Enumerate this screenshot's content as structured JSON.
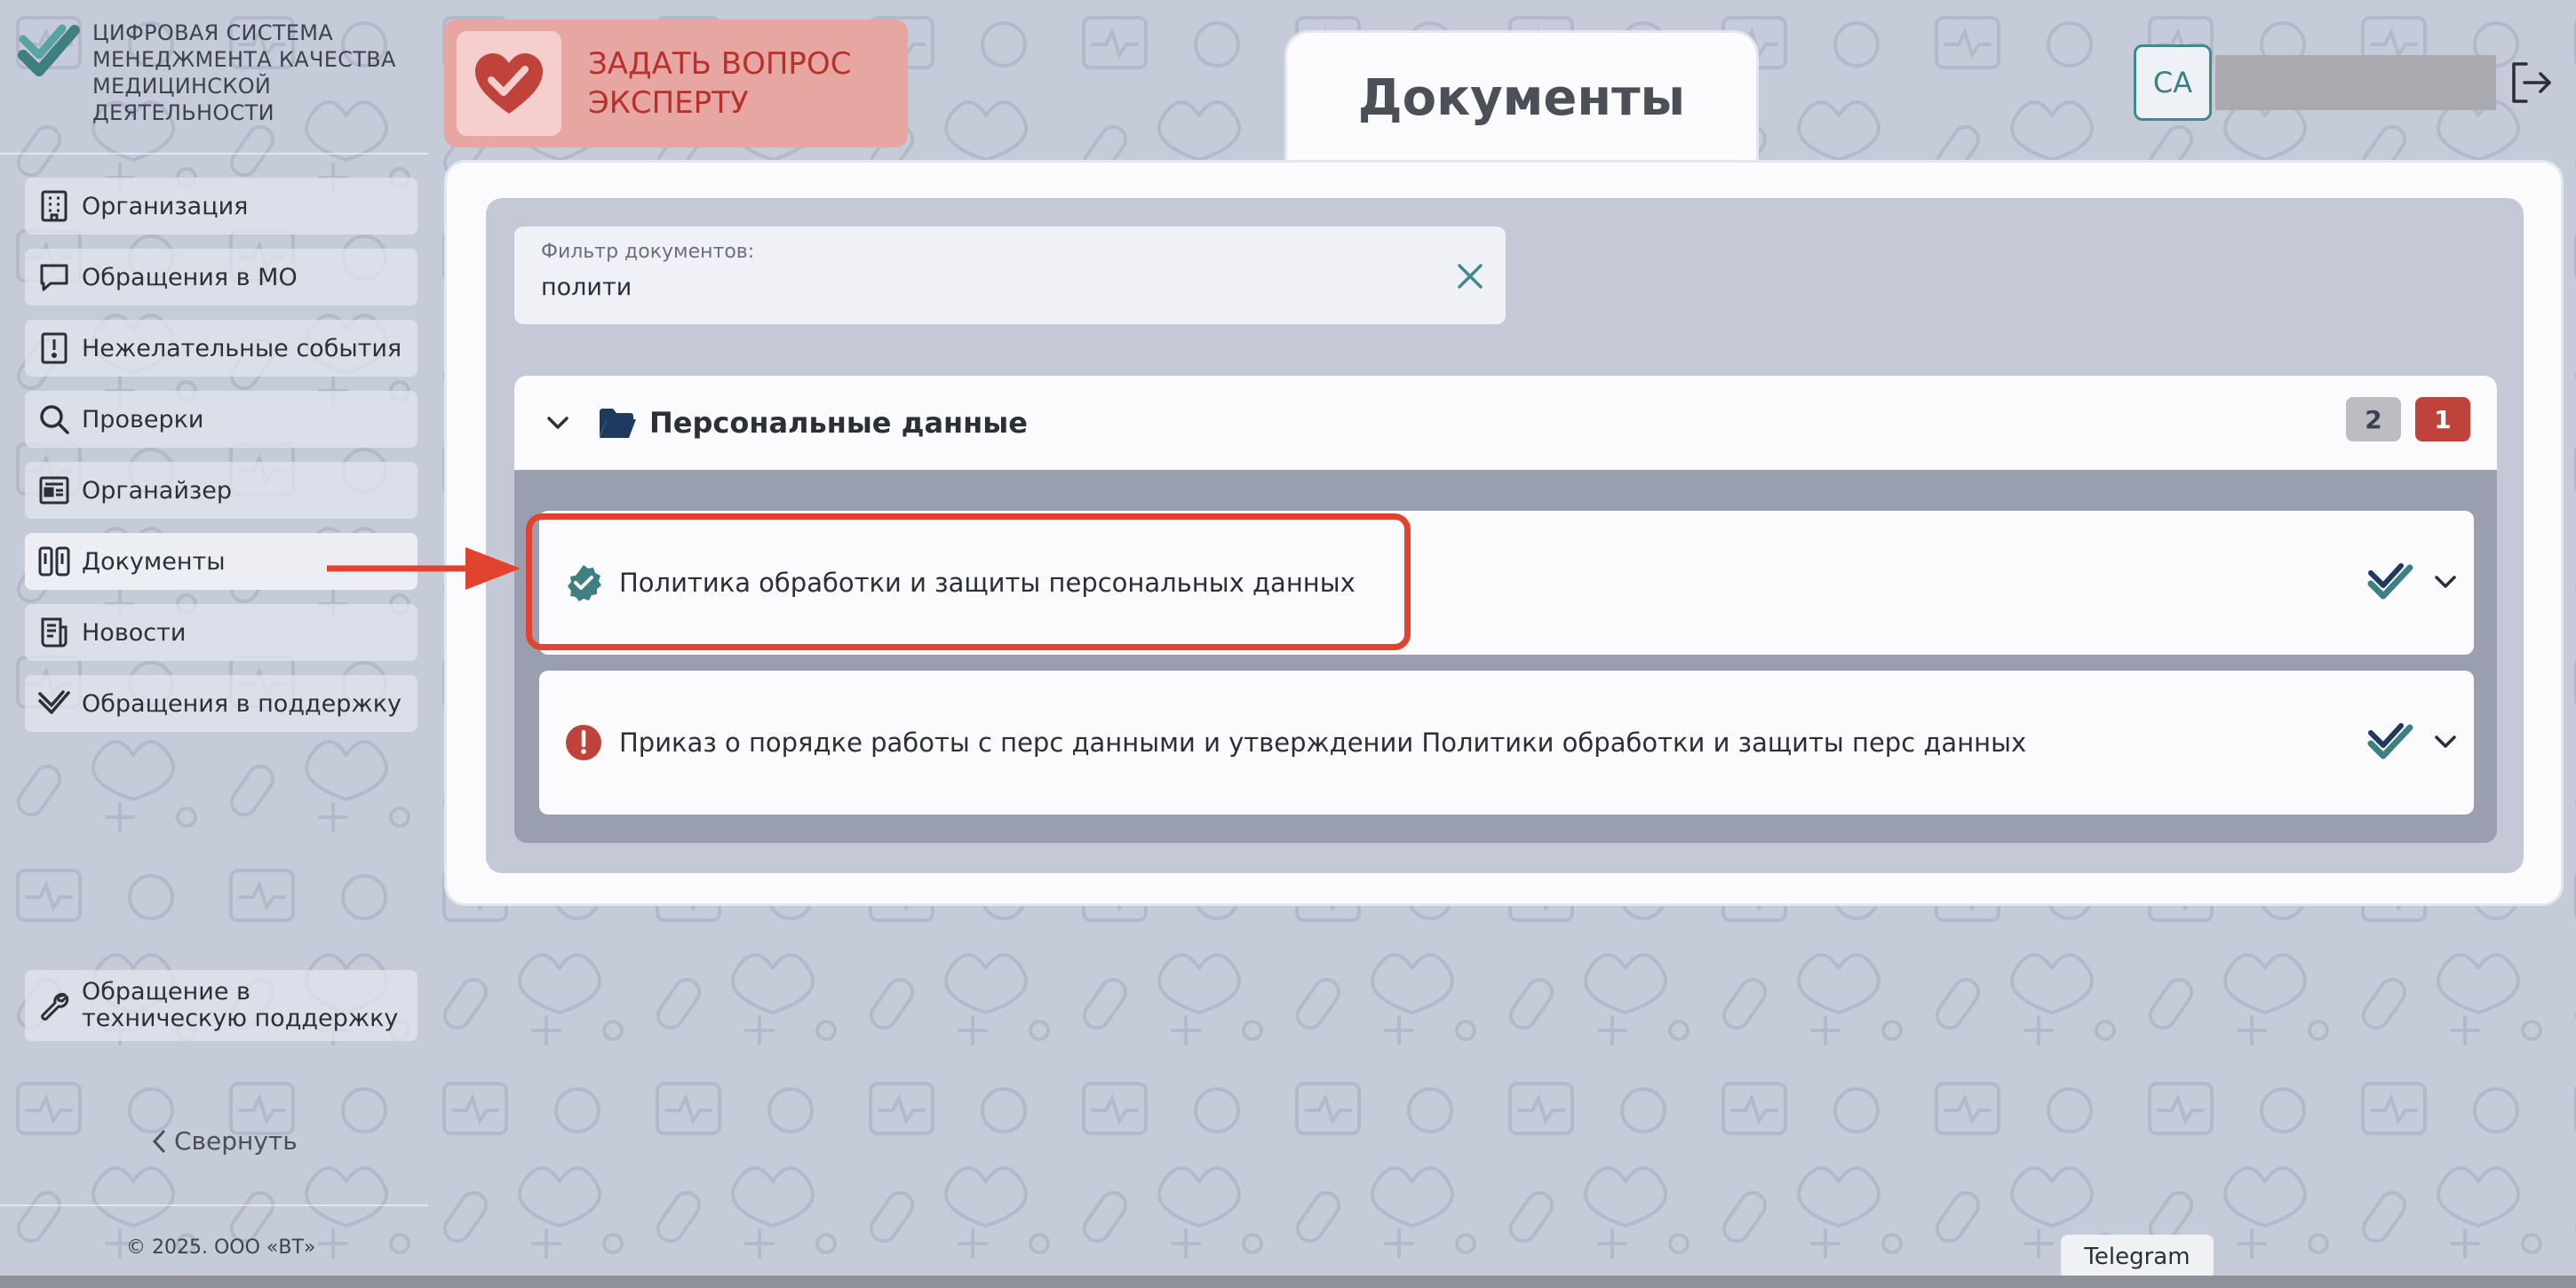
{
  "brand": {
    "lines": [
      "Цифровая система",
      "менеджмента качества",
      "медицинской",
      "деятельности"
    ]
  },
  "ask_expert": {
    "lines": [
      "ЗАДАТЬ ВОПРОС",
      "ЭКСПЕРТУ"
    ]
  },
  "sidebar": {
    "items": [
      {
        "label": "Организация",
        "icon": "building-icon"
      },
      {
        "label": "Обращения в МО",
        "icon": "chat-icon"
      },
      {
        "label": "Нежелательные события",
        "icon": "alert-book-icon"
      },
      {
        "label": "Проверки",
        "icon": "search-icon"
      },
      {
        "label": "Органайзер",
        "icon": "organizer-icon"
      },
      {
        "label": "Документы",
        "icon": "documents-icon"
      },
      {
        "label": "Новости",
        "icon": "news-icon"
      },
      {
        "label": "Обращения в поддержку",
        "icon": "support-check-icon"
      }
    ],
    "active_index": 5,
    "tech_support_label": "Обращение в техническую поддержку",
    "collapse_label": "Свернуть",
    "copyright": "© 2025. ООО «ВТ»"
  },
  "page": {
    "tab_title": "Документы"
  },
  "user": {
    "initials": "СА"
  },
  "filter": {
    "label": "Фильтр документов:",
    "value": "полити"
  },
  "folder": {
    "title": "Персональные данные",
    "badge_count_gray": "2",
    "badge_count_red": "1",
    "documents": [
      {
        "title": "Политика обработки и защиты персональных данных",
        "status": "approved"
      },
      {
        "title": "Приказ о порядке работы с перс данными и утверждении Политики обработки и защиты перс данных",
        "status": "attention"
      }
    ]
  },
  "footer": {
    "telegram_label": "Telegram"
  },
  "colors": {
    "accent_teal": "#3f7f81",
    "danger_red": "#c0433b",
    "highlight": "#e2432f",
    "background": "#c6cbd9"
  }
}
